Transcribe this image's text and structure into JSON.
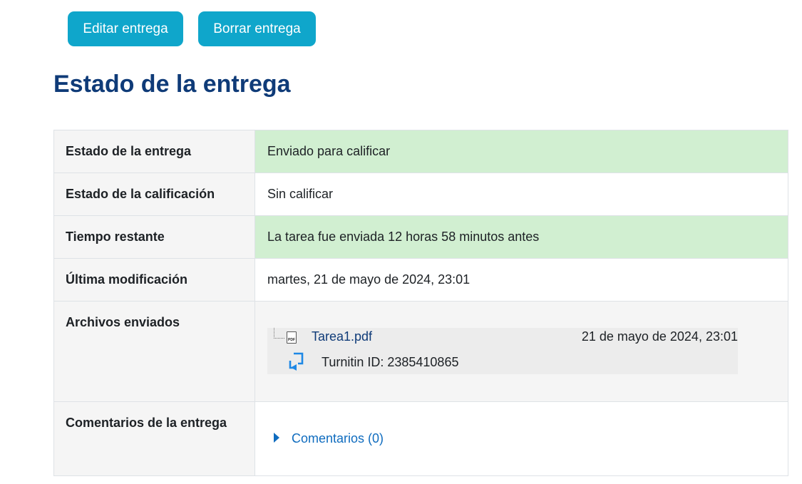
{
  "actions": {
    "edit_label": "Editar entrega",
    "delete_label": "Borrar entrega"
  },
  "heading": "Estado de la entrega",
  "rows": {
    "submission_status": {
      "label": "Estado de la entrega",
      "value": "Enviado para calificar"
    },
    "grading_status": {
      "label": "Estado de la calificación",
      "value": "Sin calificar"
    },
    "time_remaining": {
      "label": "Tiempo restante",
      "value": "La tarea fue enviada 12 horas 58 minutos antes"
    },
    "last_modified": {
      "label": "Última modificación",
      "value": "martes, 21 de mayo de 2024, 23:01"
    },
    "files": {
      "label": "Archivos enviados",
      "file_name": "Tarea1.pdf",
      "file_date": "21 de mayo de 2024, 23:01",
      "file_icon": "pdf-icon",
      "file_icon_text": "PDF",
      "turnitin_icon": "turnitin-icon",
      "turnitin_id": "Turnitin ID: 2385410865"
    },
    "comments": {
      "label": "Comentarios de la entrega",
      "toggle_label": "Comentarios (0)"
    }
  },
  "colors": {
    "button_bg": "#0fa6cb",
    "heading": "#0f3b78",
    "success_bg": "#d1efd1",
    "link": "#0f6cbf"
  }
}
